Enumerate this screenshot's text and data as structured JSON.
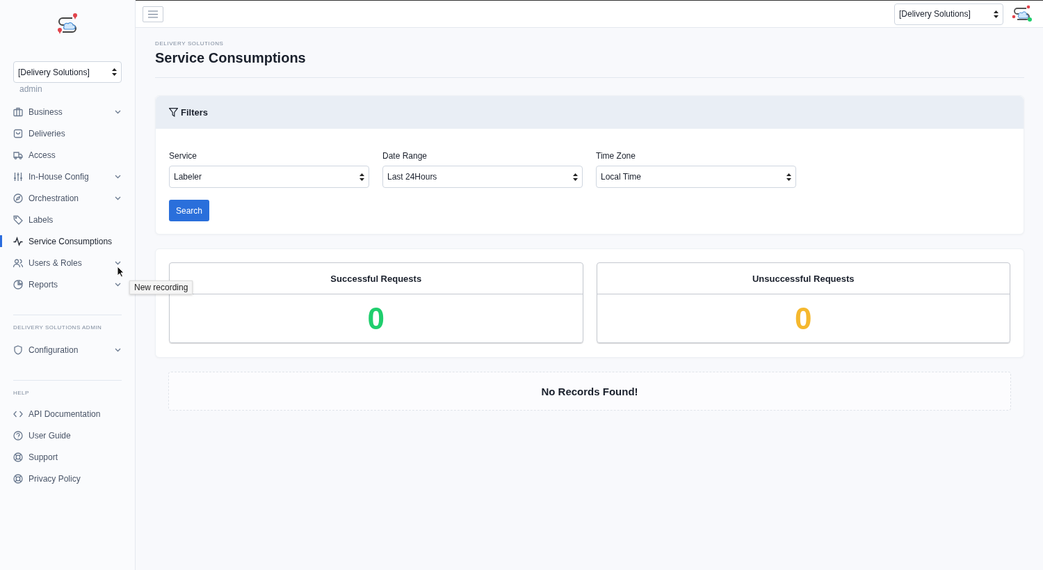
{
  "sidebar": {
    "account_select": {
      "value": "[Delivery Solutions]"
    },
    "role": "admin",
    "items": [
      {
        "label": "Business",
        "has_submenu": true,
        "selected": false
      },
      {
        "label": "Deliveries",
        "has_submenu": false,
        "selected": false
      },
      {
        "label": "Access",
        "has_submenu": false,
        "selected": false
      },
      {
        "label": "In-House Config",
        "has_submenu": true,
        "selected": false
      },
      {
        "label": "Orchestration",
        "has_submenu": true,
        "selected": false
      },
      {
        "label": "Labels",
        "has_submenu": false,
        "selected": false
      },
      {
        "label": "Service Consumptions",
        "has_submenu": false,
        "selected": true
      },
      {
        "label": "Users & Roles",
        "has_submenu": true,
        "selected": false
      },
      {
        "label": "Reports",
        "has_submenu": true,
        "selected": false
      }
    ],
    "admin_section": {
      "heading": "DELIVERY SOLUTIONS ADMIN",
      "items": [
        {
          "label": "Configuration",
          "has_submenu": true,
          "selected": false
        }
      ]
    },
    "help_section": {
      "heading": "HELP",
      "items": [
        {
          "label": "API Documentation",
          "has_submenu": false,
          "selected": false
        },
        {
          "label": "User Guide",
          "has_submenu": false,
          "selected": false
        },
        {
          "label": "Support",
          "has_submenu": false,
          "selected": false
        },
        {
          "label": "Privacy Policy",
          "has_submenu": false,
          "selected": false
        }
      ]
    }
  },
  "tooltip": "New recording",
  "topbar": {
    "account_select": {
      "value": "[Delivery Solutions]"
    }
  },
  "page": {
    "breadcrumb": "DELIVERY SOLUTIONS",
    "title": "Service Consumptions"
  },
  "filters": {
    "title": "Filters",
    "fields": [
      {
        "label": "Service",
        "value": "Labeler"
      },
      {
        "label": "Date Range",
        "value": "Last 24Hours"
      },
      {
        "label": "Time Zone",
        "value": "Local Time"
      }
    ],
    "search_button": "Search"
  },
  "stats": [
    {
      "title": "Successful Requests",
      "value": "0",
      "color": "#1fce6d"
    },
    {
      "title": "Unsuccessful Requests",
      "value": "0",
      "color": "#f5b82e"
    }
  ],
  "empty_message": "No Records Found!"
}
